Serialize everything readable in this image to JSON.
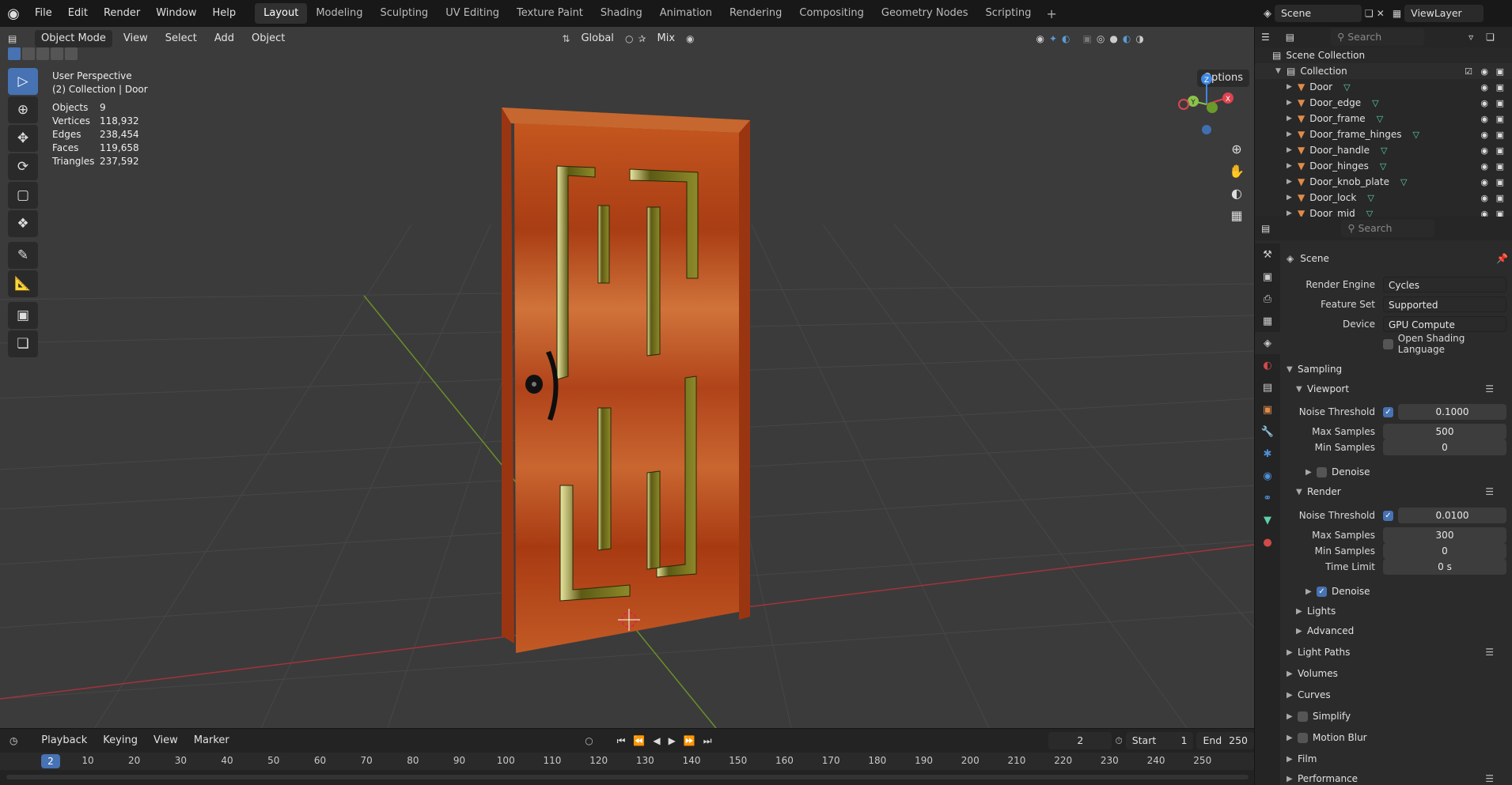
{
  "top_menu": [
    "File",
    "Edit",
    "Render",
    "Window",
    "Help"
  ],
  "workspaces": [
    "Layout",
    "Modeling",
    "Sculpting",
    "UV Editing",
    "Texture Paint",
    "Shading",
    "Animation",
    "Rendering",
    "Compositing",
    "Geometry Nodes",
    "Scripting"
  ],
  "active_workspace": "Layout",
  "scene_name": "Scene",
  "view_layer": "ViewLayer",
  "viewport": {
    "mode": "Object Mode",
    "menus": [
      "View",
      "Select",
      "Add",
      "Object"
    ],
    "transform_orientation": "Global",
    "snap_mode": "Mix",
    "options_label": "Options",
    "perspective_label": "User Perspective",
    "collection_label": "(2) Collection | Door",
    "stats": [
      {
        "label": "Objects",
        "value": "9"
      },
      {
        "label": "Vertices",
        "value": "118,932"
      },
      {
        "label": "Edges",
        "value": "238,454"
      },
      {
        "label": "Faces",
        "value": "119,658"
      },
      {
        "label": "Triangles",
        "value": "237,592"
      }
    ],
    "gizmo_axes": {
      "x": "X",
      "y": "Y",
      "z": "Z"
    }
  },
  "timeline": {
    "menus": [
      "Playback",
      "Keying",
      "View",
      "Marker"
    ],
    "current_frame": "2",
    "start_label": "Start",
    "start": "1",
    "end_label": "End",
    "end": "250",
    "ruler_ticks": [
      "10",
      "20",
      "30",
      "40",
      "50",
      "60",
      "70",
      "80",
      "90",
      "100",
      "110",
      "120",
      "130",
      "140",
      "150",
      "160",
      "170",
      "180",
      "190",
      "200",
      "210",
      "220",
      "230",
      "240",
      "250"
    ],
    "playhead": "2"
  },
  "outliner": {
    "search_placeholder": "Search",
    "root": "Scene Collection",
    "collection": "Collection",
    "objects": [
      "Door",
      "Door_edge",
      "Door_frame",
      "Door_frame_hinges",
      "Door_handle",
      "Door_hinges",
      "Door_knob_plate",
      "Door_lock",
      "Door_mid"
    ]
  },
  "properties": {
    "search_placeholder": "Search",
    "context": "Scene",
    "render_engine_label": "Render Engine",
    "render_engine": "Cycles",
    "feature_set_label": "Feature Set",
    "feature_set": "Supported",
    "device_label": "Device",
    "device": "GPU Compute",
    "osl_label": "Open Shading Language",
    "sampling": "Sampling",
    "viewport_panel": "Viewport",
    "vp_noise_label": "Noise Threshold",
    "vp_noise": "0.1000",
    "vp_max_label": "Max Samples",
    "vp_max": "500",
    "vp_min_label": "Min Samples",
    "vp_min": "0",
    "denoise_label": "Denoise",
    "render_panel": "Render",
    "r_noise_label": "Noise Threshold",
    "r_noise": "0.0100",
    "r_max_label": "Max Samples",
    "r_max": "300",
    "r_min_label": "Min Samples",
    "r_min": "0",
    "time_limit_label": "Time Limit",
    "time_limit": "0 s",
    "lights": "Lights",
    "advanced": "Advanced",
    "light_paths": "Light Paths",
    "volumes": "Volumes",
    "curves": "Curves",
    "simplify": "Simplify",
    "motion_blur": "Motion Blur",
    "film": "Film",
    "performance": "Performance"
  },
  "colors": {
    "accent": "#4772b3",
    "x_axis": "#e0434f",
    "y_axis": "#8bc34a",
    "z_axis": "#3f87e0",
    "wood": "#b8461a",
    "glass": "#7a6b18"
  }
}
